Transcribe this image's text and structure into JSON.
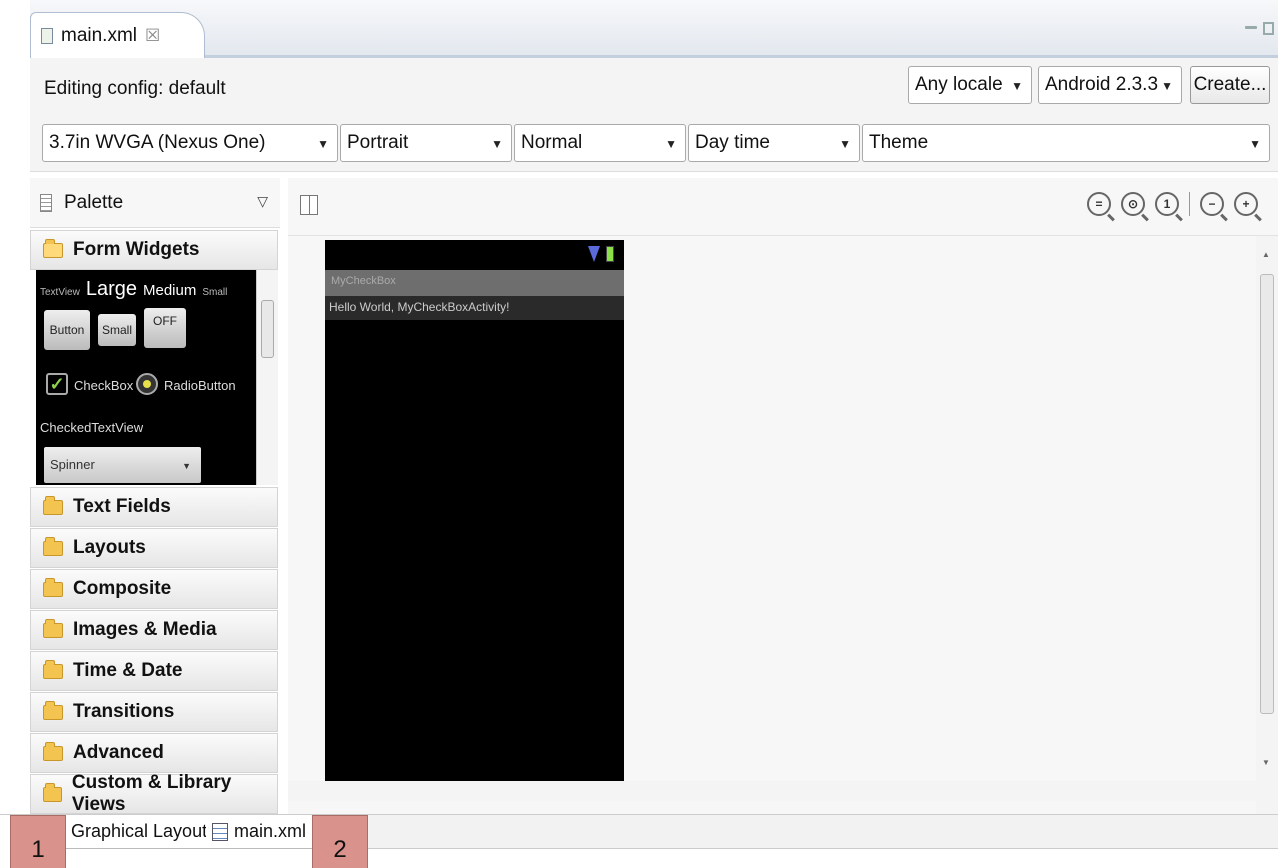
{
  "editor_tab": {
    "label": "main.xml",
    "close_glyph": "☒"
  },
  "config": {
    "label": "Editing config:  default",
    "locale": "Any locale",
    "target": "Android 2.3.3",
    "create_label": "Create..."
  },
  "device_row": {
    "device": "3.7in WVGA (Nexus One)",
    "orientation": "Portrait",
    "dock": "Normal",
    "night": "Day time",
    "theme": "Theme"
  },
  "palette": {
    "title": "Palette",
    "open_category": "Form Widgets",
    "widgets": {
      "textview": "TextView",
      "large": "Large",
      "medium": "Medium",
      "small": "Small",
      "button": "Button",
      "small_button": "Small",
      "toggle": "OFF",
      "checkbox": "CheckBox",
      "radio": "RadioButton",
      "checked_text": "CheckedTextView",
      "spinner": "Spinner"
    },
    "categories": [
      "Text Fields",
      "Layouts",
      "Composite",
      "Images & Media",
      "Time & Date",
      "Transitions",
      "Advanced",
      "Custom & Library Views"
    ]
  },
  "zoom": {
    "z1": "=",
    "z2": "⊙",
    "z3": "1",
    "z4": "−",
    "z5": "+"
  },
  "phone": {
    "title": "MyCheckBox",
    "hello": "Hello World, MyCheckBoxActivity!"
  },
  "bottom_tabs": {
    "graphical": "Graphical Layout",
    "xml": "main.xml"
  },
  "markers": {
    "m1": "1",
    "m2": "2"
  },
  "colors": {
    "marker": "#d9928c",
    "folder": "#f4c450"
  }
}
